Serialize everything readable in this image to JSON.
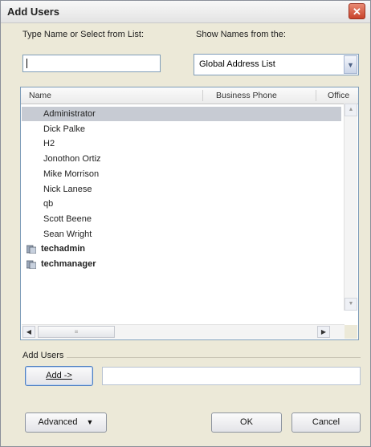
{
  "window": {
    "title": "Add Users",
    "close_glyph": "✕"
  },
  "search": {
    "label": "Type Name or Select from List:",
    "value": ""
  },
  "address_book": {
    "label": "Show Names from the:",
    "selected": "Global Address List"
  },
  "list": {
    "columns": [
      "Name",
      "Business Phone",
      "Office"
    ],
    "rows": [
      {
        "name": "Administrator",
        "selected": true,
        "type": "user"
      },
      {
        "name": "Dick Palke",
        "type": "user"
      },
      {
        "name": "H2",
        "type": "user"
      },
      {
        "name": "Jonothon Ortiz",
        "type": "user"
      },
      {
        "name": "Mike Morrison",
        "type": "user"
      },
      {
        "name": "Nick Lanese",
        "type": "user"
      },
      {
        "name": "qb",
        "type": "user"
      },
      {
        "name": "Scott Beene",
        "type": "user"
      },
      {
        "name": "Sean Wright",
        "type": "user"
      },
      {
        "name": "techadmin",
        "type": "group"
      },
      {
        "name": "techmanager",
        "type": "group"
      }
    ]
  },
  "add_users": {
    "group_label": "Add Users",
    "add_button": "Add ->",
    "field_value": ""
  },
  "footer": {
    "advanced_button": "Advanced",
    "ok_button": "OK",
    "cancel_button": "Cancel"
  },
  "colors": {
    "selection": "#c7cbd3",
    "close_button": "#c9432b",
    "dialog_bg": "#ece9d8"
  }
}
